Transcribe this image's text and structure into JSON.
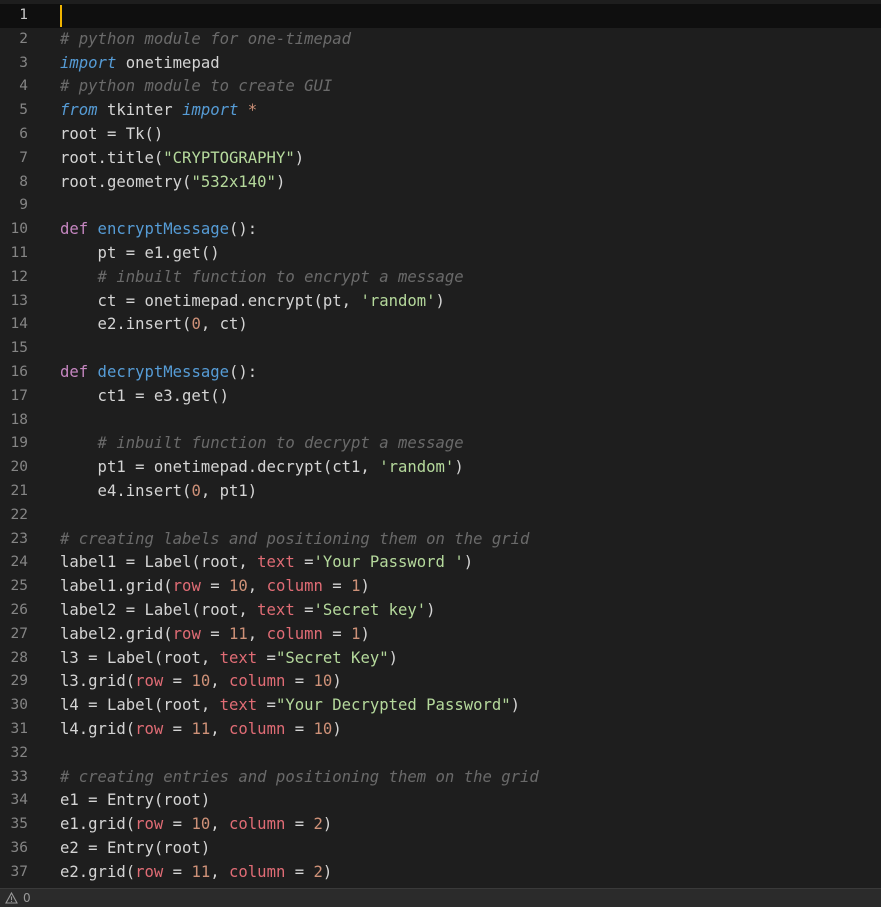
{
  "theme": {
    "keyword": "#569cd6",
    "control": "#c586c0",
    "function": "#dcdcaa",
    "string": "#ce9178",
    "string_alt": "#b5d99c",
    "comment": "#6a6a6a",
    "number": "#b5cea8",
    "param": "#e06c75",
    "default": "#d4d4d4",
    "cursor": "#f0b400"
  },
  "editor": {
    "lines": [
      {
        "n": "1",
        "tokens": []
      },
      {
        "n": "2",
        "tokens": [
          {
            "t": "# python module for one-timepad",
            "c": "comment"
          }
        ]
      },
      {
        "n": "3",
        "tokens": [
          {
            "t": "import",
            "c": "kwi"
          },
          {
            "t": " onetimepad",
            "c": "default"
          }
        ]
      },
      {
        "n": "4",
        "tokens": [
          {
            "t": "# python module to create GUI",
            "c": "comment"
          }
        ]
      },
      {
        "n": "5",
        "tokens": [
          {
            "t": "from",
            "c": "kwi"
          },
          {
            "t": " tkinter ",
            "c": "default"
          },
          {
            "t": "import",
            "c": "kwi"
          },
          {
            "t": " *",
            "c": "op"
          }
        ]
      },
      {
        "n": "6",
        "tokens": [
          {
            "t": "root = Tk()",
            "c": "default"
          }
        ]
      },
      {
        "n": "7",
        "tokens": [
          {
            "t": "root.title(",
            "c": "default"
          },
          {
            "t": "\"CRYPTOGRAPHY\"",
            "c": "str"
          },
          {
            "t": ")",
            "c": "default"
          }
        ]
      },
      {
        "n": "8",
        "tokens": [
          {
            "t": "root.geometry(",
            "c": "default"
          },
          {
            "t": "\"532x140\"",
            "c": "str"
          },
          {
            "t": ")",
            "c": "default"
          }
        ]
      },
      {
        "n": "9",
        "tokens": []
      },
      {
        "n": "10",
        "tokens": [
          {
            "t": "def",
            "c": "def"
          },
          {
            "t": " encryptMessage",
            "c": "fn"
          },
          {
            "t": "():",
            "c": "default"
          }
        ]
      },
      {
        "n": "11",
        "tokens": [
          {
            "t": "    pt = e1.get()",
            "c": "default"
          }
        ]
      },
      {
        "n": "12",
        "tokens": [
          {
            "t": "    # inbuilt function to encrypt a message",
            "c": "comment"
          }
        ]
      },
      {
        "n": "13",
        "tokens": [
          {
            "t": "    ct = onetimepad.encrypt(pt, ",
            "c": "default"
          },
          {
            "t": "'random'",
            "c": "str"
          },
          {
            "t": ")",
            "c": "default"
          }
        ]
      },
      {
        "n": "14",
        "tokens": [
          {
            "t": "    e2.insert(",
            "c": "default"
          },
          {
            "t": "0",
            "c": "num"
          },
          {
            "t": ", ct)",
            "c": "default"
          }
        ]
      },
      {
        "n": "15",
        "tokens": []
      },
      {
        "n": "16",
        "tokens": [
          {
            "t": "def",
            "c": "def"
          },
          {
            "t": " decryptMessage",
            "c": "fn"
          },
          {
            "t": "():",
            "c": "default"
          }
        ]
      },
      {
        "n": "17",
        "tokens": [
          {
            "t": "    ct1 = e3.get()",
            "c": "default"
          }
        ]
      },
      {
        "n": "18",
        "tokens": []
      },
      {
        "n": "19",
        "tokens": [
          {
            "t": "    # inbuilt function to decrypt a message",
            "c": "comment"
          }
        ]
      },
      {
        "n": "20",
        "tokens": [
          {
            "t": "    pt1 = onetimepad.decrypt(ct1, ",
            "c": "default"
          },
          {
            "t": "'random'",
            "c": "str"
          },
          {
            "t": ")",
            "c": "default"
          }
        ]
      },
      {
        "n": "21",
        "tokens": [
          {
            "t": "    e4.insert(",
            "c": "default"
          },
          {
            "t": "0",
            "c": "num"
          },
          {
            "t": ", pt1)",
            "c": "default"
          }
        ]
      },
      {
        "n": "22",
        "tokens": []
      },
      {
        "n": "23",
        "tokens": [
          {
            "t": "# creating labels and positioning them on the grid",
            "c": "comment"
          }
        ]
      },
      {
        "n": "24",
        "tokens": [
          {
            "t": "label1 = Label(root, ",
            "c": "default"
          },
          {
            "t": "text",
            "c": "param"
          },
          {
            "t": " =",
            "c": "default"
          },
          {
            "t": "'Your Password '",
            "c": "str"
          },
          {
            "t": ")",
            "c": "default"
          }
        ]
      },
      {
        "n": "25",
        "tokens": [
          {
            "t": "label1.grid(",
            "c": "default"
          },
          {
            "t": "row",
            "c": "param"
          },
          {
            "t": " = ",
            "c": "default"
          },
          {
            "t": "10",
            "c": "num"
          },
          {
            "t": ", ",
            "c": "default"
          },
          {
            "t": "column",
            "c": "param"
          },
          {
            "t": " = ",
            "c": "default"
          },
          {
            "t": "1",
            "c": "num"
          },
          {
            "t": ")",
            "c": "default"
          }
        ]
      },
      {
        "n": "26",
        "tokens": [
          {
            "t": "label2 = Label(root, ",
            "c": "default"
          },
          {
            "t": "text",
            "c": "param"
          },
          {
            "t": " =",
            "c": "default"
          },
          {
            "t": "'Secret key'",
            "c": "str"
          },
          {
            "t": ")",
            "c": "default"
          }
        ]
      },
      {
        "n": "27",
        "tokens": [
          {
            "t": "label2.grid(",
            "c": "default"
          },
          {
            "t": "row",
            "c": "param"
          },
          {
            "t": " = ",
            "c": "default"
          },
          {
            "t": "11",
            "c": "num"
          },
          {
            "t": ", ",
            "c": "default"
          },
          {
            "t": "column",
            "c": "param"
          },
          {
            "t": " = ",
            "c": "default"
          },
          {
            "t": "1",
            "c": "num"
          },
          {
            "t": ")",
            "c": "default"
          }
        ]
      },
      {
        "n": "28",
        "tokens": [
          {
            "t": "l3 = Label(root, ",
            "c": "default"
          },
          {
            "t": "text",
            "c": "param"
          },
          {
            "t": " =",
            "c": "default"
          },
          {
            "t": "\"Secret Key\"",
            "c": "str"
          },
          {
            "t": ")",
            "c": "default"
          }
        ]
      },
      {
        "n": "29",
        "tokens": [
          {
            "t": "l3.grid(",
            "c": "default"
          },
          {
            "t": "row",
            "c": "param"
          },
          {
            "t": " = ",
            "c": "default"
          },
          {
            "t": "10",
            "c": "num"
          },
          {
            "t": ", ",
            "c": "default"
          },
          {
            "t": "column",
            "c": "param"
          },
          {
            "t": " = ",
            "c": "default"
          },
          {
            "t": "10",
            "c": "num"
          },
          {
            "t": ")",
            "c": "default"
          }
        ]
      },
      {
        "n": "30",
        "tokens": [
          {
            "t": "l4 = Label(root, ",
            "c": "default"
          },
          {
            "t": "text",
            "c": "param"
          },
          {
            "t": " =",
            "c": "default"
          },
          {
            "t": "\"Your Decrypted Password\"",
            "c": "str"
          },
          {
            "t": ")",
            "c": "default"
          }
        ]
      },
      {
        "n": "31",
        "tokens": [
          {
            "t": "l4.grid(",
            "c": "default"
          },
          {
            "t": "row",
            "c": "param"
          },
          {
            "t": " = ",
            "c": "default"
          },
          {
            "t": "11",
            "c": "num"
          },
          {
            "t": ", ",
            "c": "default"
          },
          {
            "t": "column",
            "c": "param"
          },
          {
            "t": " = ",
            "c": "default"
          },
          {
            "t": "10",
            "c": "num"
          },
          {
            "t": ")",
            "c": "default"
          }
        ]
      },
      {
        "n": "32",
        "tokens": []
      },
      {
        "n": "33",
        "tokens": [
          {
            "t": "# creating entries and positioning them on the grid",
            "c": "comment"
          }
        ]
      },
      {
        "n": "34",
        "tokens": [
          {
            "t": "e1 = Entry(root)",
            "c": "default"
          }
        ]
      },
      {
        "n": "35",
        "tokens": [
          {
            "t": "e1.grid(",
            "c": "default"
          },
          {
            "t": "row",
            "c": "param"
          },
          {
            "t": " = ",
            "c": "default"
          },
          {
            "t": "10",
            "c": "num"
          },
          {
            "t": ", ",
            "c": "default"
          },
          {
            "t": "column",
            "c": "param"
          },
          {
            "t": " = ",
            "c": "default"
          },
          {
            "t": "2",
            "c": "num"
          },
          {
            "t": ")",
            "c": "default"
          }
        ]
      },
      {
        "n": "36",
        "tokens": [
          {
            "t": "e2 = Entry(root)",
            "c": "default"
          }
        ]
      },
      {
        "n": "37",
        "tokens": [
          {
            "t": "e2.grid(",
            "c": "default"
          },
          {
            "t": "row",
            "c": "param"
          },
          {
            "t": " = ",
            "c": "default"
          },
          {
            "t": "11",
            "c": "num"
          },
          {
            "t": ", ",
            "c": "default"
          },
          {
            "t": "column",
            "c": "param"
          },
          {
            "t": " = ",
            "c": "default"
          },
          {
            "t": "2",
            "c": "num"
          },
          {
            "t": ")",
            "c": "default"
          }
        ]
      }
    ]
  },
  "statusbar": {
    "problems_icon": "warning-icon",
    "problems_count": "0"
  }
}
